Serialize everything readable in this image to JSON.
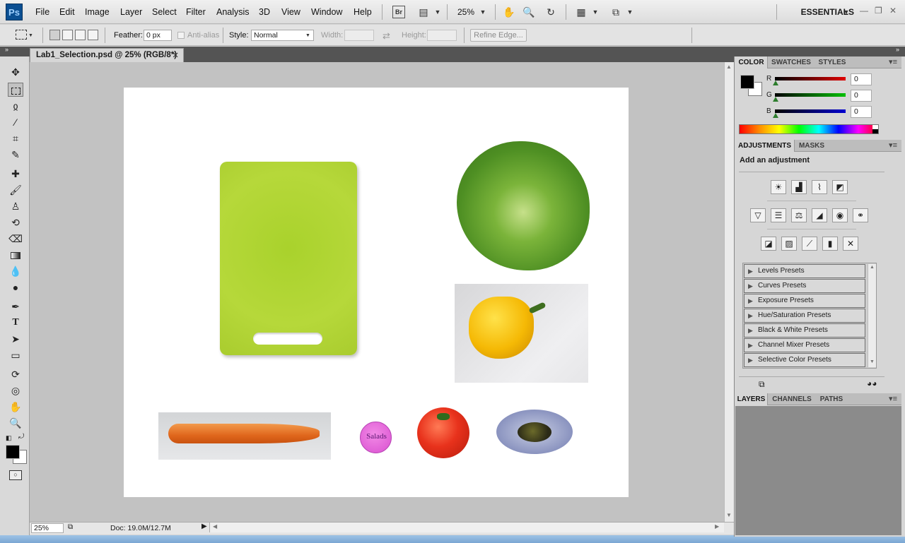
{
  "app": {
    "logo": "Ps"
  },
  "menu": [
    "File",
    "Edit",
    "Image",
    "Layer",
    "Select",
    "Filter",
    "Analysis",
    "3D",
    "View",
    "Window",
    "Help"
  ],
  "menubar": {
    "bridge_label": "Br",
    "zoom": "25%",
    "workspace": "ESSENTIALS"
  },
  "options": {
    "feather_label": "Feather:",
    "feather_value": "0 px",
    "antialias_label": "Anti-alias",
    "style_label": "Style:",
    "style_value": "Normal",
    "width_label": "Width:",
    "height_label": "Height:",
    "refine_edge": "Refine Edge..."
  },
  "document": {
    "tab_title": "Lab1_Selection.psd @ 25% (RGB/8*)",
    "logo_text": "Salads",
    "zoom": "25%",
    "doc_size": "Doc: 19.0M/12.7M"
  },
  "color_panel": {
    "tabs": [
      "COLOR",
      "SWATCHES",
      "STYLES"
    ],
    "channels": [
      {
        "label": "R",
        "value": "0",
        "color": "#d00000"
      },
      {
        "label": "G",
        "value": "0",
        "color": "#00b000"
      },
      {
        "label": "B",
        "value": "0",
        "color": "#0000c0"
      }
    ]
  },
  "adjustments_panel": {
    "tabs": [
      "ADJUSTMENTS",
      "MASKS"
    ],
    "heading": "Add an adjustment",
    "presets": [
      "Levels Presets",
      "Curves Presets",
      "Exposure Presets",
      "Hue/Saturation Presets",
      "Black & White Presets",
      "Channel Mixer Presets",
      "Selective Color Presets"
    ]
  },
  "layers_panel": {
    "tabs": [
      "LAYERS",
      "CHANNELS",
      "PATHS"
    ]
  },
  "colors": {
    "accent": "#0b4f92",
    "foreground": "#000000",
    "background": "#ffffff",
    "board": "#b6d83a"
  }
}
